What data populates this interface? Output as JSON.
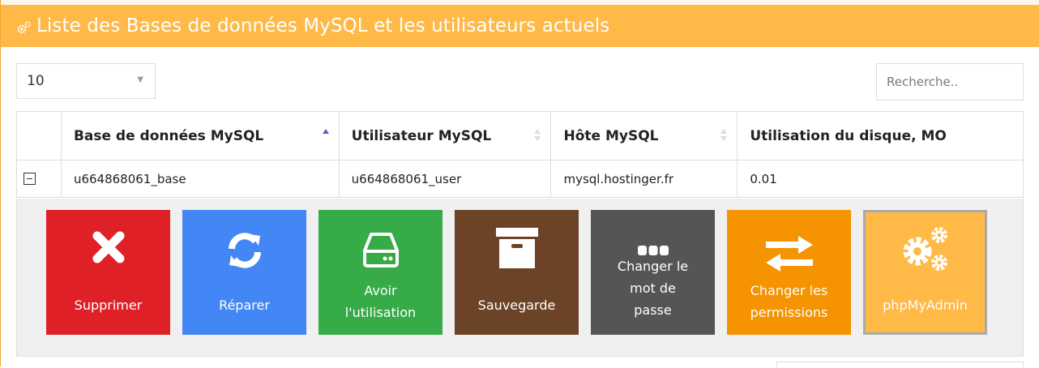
{
  "panel": {
    "title": "Liste des Bases de données MySQL et les utilisateurs actuels",
    "icon": "gears-icon",
    "colors": {
      "header": "#ffb946",
      "header_text": "#ffffff"
    }
  },
  "controls": {
    "page_size": "10",
    "search_placeholder": "Recherche.."
  },
  "table": {
    "columns": [
      "Base de données MySQL",
      "Utilisateur MySQL",
      "Hôte MySQL",
      "Utilisation du disque, MO"
    ],
    "sort": {
      "column": "Base de données MySQL",
      "direction": "asc"
    },
    "rows": [
      {
        "database": "u664868061_base",
        "user": "u664868061_user",
        "host": "mysql.hostinger.fr",
        "disk": "0.01",
        "expanded": true
      }
    ]
  },
  "actions": [
    {
      "key": "delete",
      "label": "Supprimer",
      "icon": "x-icon",
      "color": "#e02027"
    },
    {
      "key": "repair",
      "label": "Réparer",
      "icon": "refresh-icon",
      "color": "#4386f5"
    },
    {
      "key": "usage",
      "label": "Avoir l'utilisation",
      "line1": "Avoir",
      "line2": "l'utilisation",
      "icon": "hdd-icon",
      "color": "#37ab48"
    },
    {
      "key": "backup",
      "label": "Sauvegarde",
      "icon": "archive-icon",
      "color": "#6d4328"
    },
    {
      "key": "password",
      "label": "Changer le mot de passe",
      "line1": "Changer le",
      "line2": "mot de",
      "line3": "passe",
      "icon": "password-dots-icon",
      "color": "#555555"
    },
    {
      "key": "permissions",
      "label": "Changer les permissions",
      "line1": "Changer les",
      "line2": "permissions",
      "icon": "exchange-icon",
      "color": "#f59300"
    },
    {
      "key": "phpmyadmin",
      "label": "phpMyAdmin",
      "icon": "gears-icon",
      "color": "#ffb946"
    }
  ]
}
